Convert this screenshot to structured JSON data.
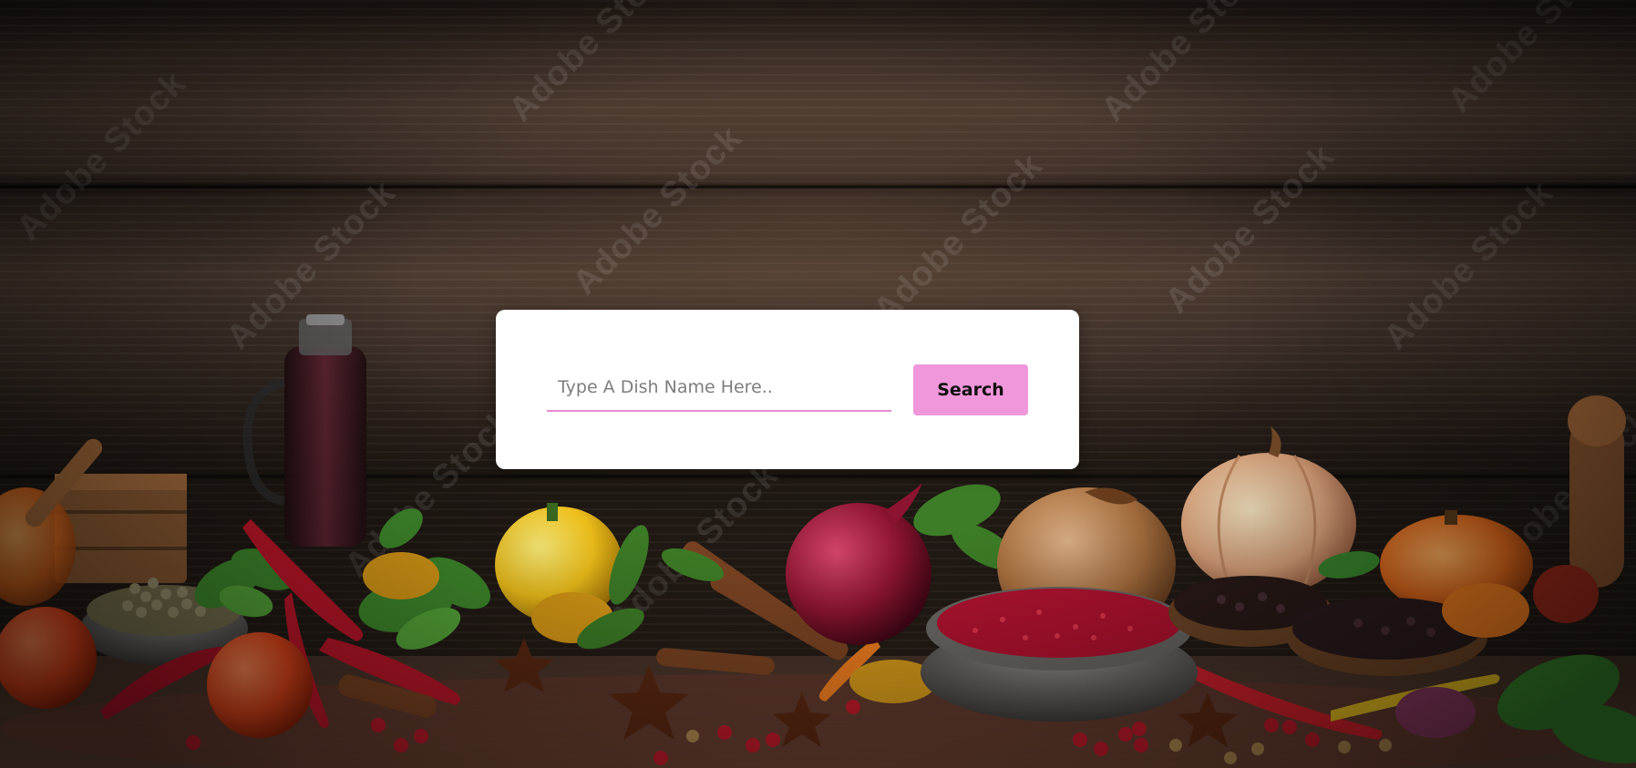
{
  "search": {
    "placeholder": "Type A Dish Name Here..",
    "value": "",
    "button_label": "Search"
  },
  "watermark": {
    "text": "Adobe Stock"
  },
  "colors": {
    "accent": "#ef97da",
    "input_underline": "#e68ad4",
    "card_background": "#ffffff"
  },
  "background": {
    "icon": "wood-spices-background-image"
  }
}
